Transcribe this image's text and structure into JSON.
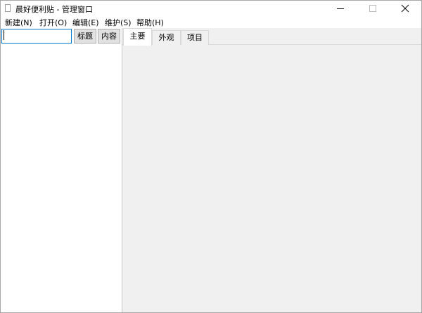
{
  "window": {
    "title": "晨好便利贴 - 管理窗口",
    "minimize_icon": "minimize-icon",
    "maximize_icon": "maximize-icon",
    "close_icon": "close-icon"
  },
  "menu": {
    "items": [
      {
        "label": "新建(N)"
      },
      {
        "label": "打开(O)"
      },
      {
        "label": "编辑(E)"
      },
      {
        "label": "维护(S)"
      },
      {
        "label": "帮助(H)"
      }
    ]
  },
  "search": {
    "value": "",
    "placeholder": ""
  },
  "filters": {
    "title_label": "标题",
    "content_label": "内容"
  },
  "tabs": {
    "items": [
      {
        "label": "主要",
        "active": true
      },
      {
        "label": "外观",
        "active": false
      },
      {
        "label": "项目",
        "active": false
      }
    ]
  },
  "colors": {
    "accent": "#0078d7",
    "panel_bg": "#f0f0f0",
    "button_bg": "#e1e1e1"
  }
}
